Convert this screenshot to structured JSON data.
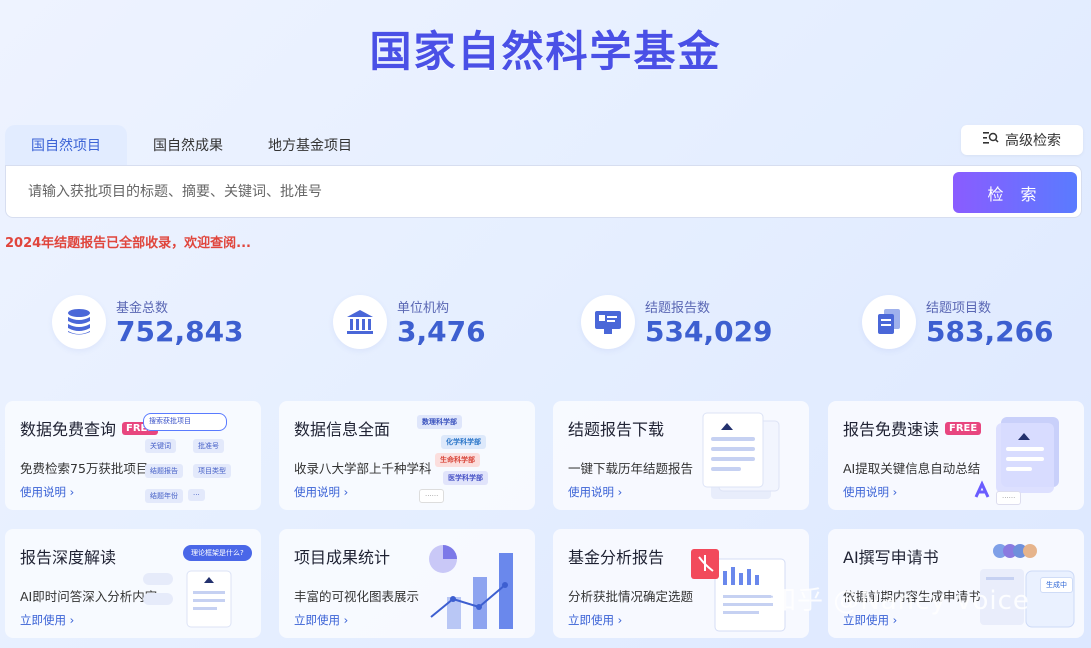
{
  "header": {
    "title": "国家自然科学基金"
  },
  "tabs": [
    {
      "label": "国自然项目",
      "active": true
    },
    {
      "label": "国自然成果"
    },
    {
      "label": "地方基金项目"
    }
  ],
  "advanced_search": {
    "label": "高级检索",
    "icon": "advanced-search-icon"
  },
  "search": {
    "placeholder": "请输入获批项目的标题、摘要、关键词、批准号",
    "value": "",
    "button_label": "检 索"
  },
  "notice": "2024年结题报告已全部收录，欢迎查阅...",
  "stats": [
    {
      "label": "基金总数",
      "value": "752,843",
      "icon": "database-icon"
    },
    {
      "label": "单位机构",
      "value": "3,476",
      "icon": "institution-icon"
    },
    {
      "label": "结题报告数",
      "value": "534,029",
      "icon": "report-icon"
    },
    {
      "label": "结题项目数",
      "value": "583,266",
      "icon": "documents-icon"
    }
  ],
  "cards": [
    {
      "title": "数据免费查询",
      "badge": "FREE",
      "desc": "免费检索75万获批项目",
      "link": "使用说明",
      "deco": {
        "search_pill": "搜索获批项目",
        "tags": [
          "关键词",
          "批准号",
          "结题报告",
          "项目类型",
          "结题年份",
          "···"
        ]
      }
    },
    {
      "title": "数据信息全面",
      "desc": "收录八大学部上千种学科",
      "link": "使用说明",
      "deco": {
        "tags": [
          "数理科学部",
          "化学科学部",
          "生命科学部",
          "医学科学部",
          "······"
        ]
      }
    },
    {
      "title": "结题报告下载",
      "desc": "一键下载历年结题报告",
      "link": "使用说明"
    },
    {
      "title": "报告免费速读",
      "badge": "FREE",
      "desc": "AI提取关键信息自动总结",
      "link": "使用说明",
      "deco": {
        "dots": "······"
      }
    },
    {
      "title": "报告深度解读",
      "desc": "AI即时问答深入分析内容",
      "link": "立即使用",
      "deco": {
        "bubble": "理论框架是什么?"
      }
    },
    {
      "title": "项目成果统计",
      "desc": "丰富的可视化图表展示",
      "link": "立即使用"
    },
    {
      "title": "基金分析报告",
      "desc": "分析获批情况确定选题",
      "link": "立即使用"
    },
    {
      "title": "AI撰写申请书",
      "desc": "依据前期内容生成申请书",
      "link": "立即使用",
      "deco": {
        "status": "生成中"
      }
    }
  ],
  "watermark": "知乎 @Nancy voice",
  "colors": {
    "accent": "#3d5fd0",
    "title": "#4a50e6",
    "notice": "#e0453c",
    "badge": "#e8467f"
  }
}
